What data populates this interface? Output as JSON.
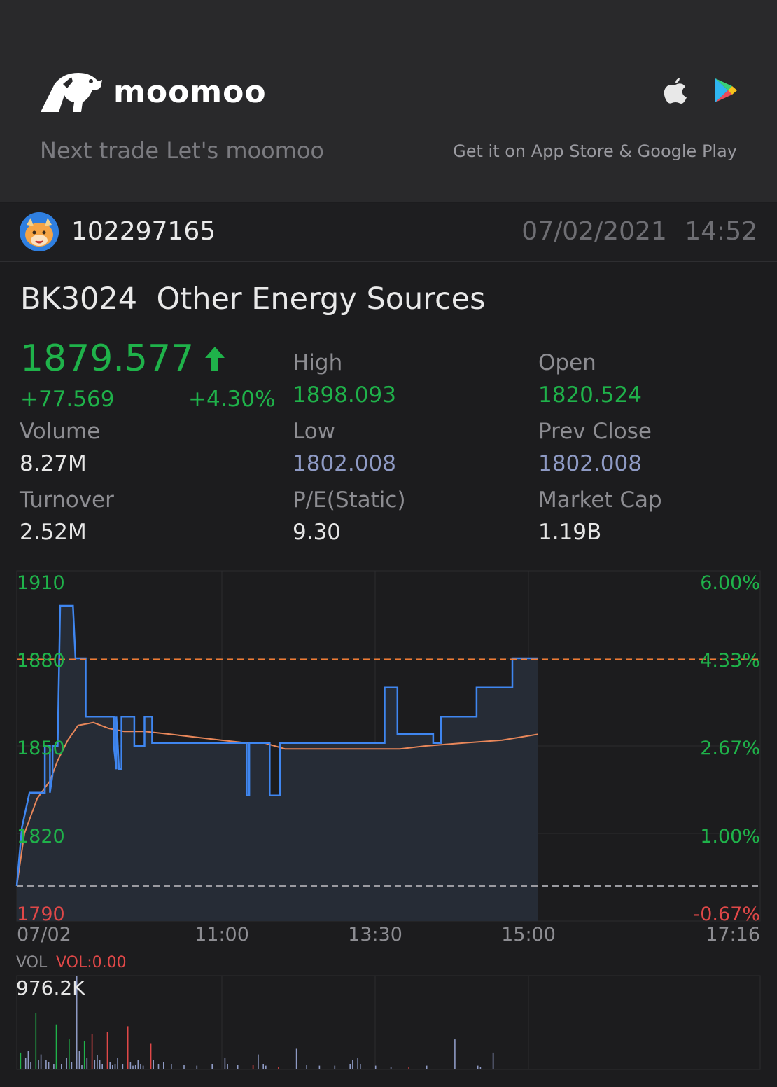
{
  "banner": {
    "brand": "moomoo",
    "tagline": "Next trade Let's moomoo",
    "store_text": "Get it on App Store & Google Play",
    "icons": [
      "apple-icon",
      "google-play-icon"
    ]
  },
  "user": {
    "id": "102297165",
    "date": "07/02/2021",
    "time": "14:52"
  },
  "stock": {
    "code": "BK3024",
    "name": "Other Energy Sources",
    "price": "1879.577",
    "change": "+77.569",
    "change_pct": "+4.30%",
    "direction_icon": "up-arrow-icon"
  },
  "quote": {
    "high_label": "High",
    "high": "1898.093",
    "open_label": "Open",
    "open": "1820.524",
    "volume_label": "Volume",
    "volume": "8.27M",
    "low_label": "Low",
    "low": "1802.008",
    "prev_close_label": "Prev Close",
    "prev_close": "1802.008",
    "turnover_label": "Turnover",
    "turnover": "2.52M",
    "pe_label": "P/E(Static)",
    "pe": "9.30",
    "market_cap_label": "Market Cap",
    "market_cap": "1.19B"
  },
  "colors": {
    "up": "#1fb24a",
    "down": "#e04848",
    "price_line": "#3f86f0",
    "avg_line": "#e8875a",
    "neutral_blue": "#8e9ac4"
  },
  "chart_data": [
    {
      "type": "line",
      "y_ticks_left": [
        "1910",
        "1880",
        "1850",
        "1820",
        "1790"
      ],
      "y_ticks_right": [
        "6.00%",
        "4.33%",
        "2.67%",
        "1.00%",
        "-0.67%"
      ],
      "x_ticks": [
        "07/02",
        "11:00",
        "13:30",
        "15:00",
        "17:16"
      ],
      "ylim": [
        1790,
        1910
      ],
      "reference_lines": {
        "current": 1879.577,
        "prev_close": 1802.008
      },
      "series": [
        {
          "values": [
            [
              0,
              1802
            ],
            [
              2,
              1822
            ],
            [
              5,
              1834
            ],
            [
              5,
              1834
            ],
            [
              11,
              1834
            ],
            [
              11,
              1850
            ],
            [
              13,
              1850
            ],
            [
              13,
              1834
            ],
            [
              14,
              1840
            ],
            [
              14,
              1850
            ],
            [
              16,
              1850
            ],
            [
              16,
              1850
            ],
            [
              17,
              1898
            ],
            [
              22,
              1898
            ],
            [
              23,
              1880
            ],
            [
              27,
              1880
            ],
            [
              27,
              1860
            ],
            [
              36,
              1860
            ],
            [
              38,
              1860
            ],
            [
              38,
              1850
            ],
            [
              39,
              1842
            ],
            [
              39,
              1860
            ],
            [
              40,
              1842
            ],
            [
              41,
              1842
            ],
            [
              41,
              1860
            ],
            [
              46,
              1860
            ],
            [
              46,
              1850
            ],
            [
              50,
              1850
            ],
            [
              50,
              1860
            ],
            [
              53,
              1860
            ],
            [
              53,
              1851
            ],
            [
              90,
              1851
            ],
            [
              90,
              1833
            ],
            [
              91,
              1833
            ],
            [
              91,
              1851
            ],
            [
              99,
              1851
            ],
            [
              99,
              1833
            ],
            [
              103,
              1833
            ],
            [
              103,
              1851
            ],
            [
              144,
              1851
            ],
            [
              144,
              1870
            ],
            [
              149,
              1870
            ],
            [
              149,
              1854
            ],
            [
              163,
              1854
            ],
            [
              163,
              1851
            ],
            [
              166,
              1851
            ],
            [
              166,
              1860
            ],
            [
              180,
              1860
            ],
            [
              180,
              1870
            ],
            [
              194,
              1870
            ],
            [
              194,
              1880
            ],
            [
              204,
              1880
            ]
          ]
        },
        {
          "values": [
            [
              0,
              1802
            ],
            [
              3,
              1820
            ],
            [
              8,
              1832
            ],
            [
              13,
              1838
            ],
            [
              16,
              1845
            ],
            [
              20,
              1852
            ],
            [
              24,
              1857
            ],
            [
              30,
              1858
            ],
            [
              36,
              1856
            ],
            [
              42,
              1855
            ],
            [
              50,
              1855
            ],
            [
              60,
              1854
            ],
            [
              70,
              1853
            ],
            [
              80,
              1852
            ],
            [
              90,
              1851
            ],
            [
              97,
              1851
            ],
            [
              105,
              1849
            ],
            [
              130,
              1849
            ],
            [
              150,
              1849
            ],
            [
              160,
              1850
            ],
            [
              175,
              1851
            ],
            [
              190,
              1852
            ],
            [
              204,
              1854
            ]
          ]
        }
      ]
    },
    {
      "type": "bar",
      "title": "VOL",
      "ylabel": "VOL:0.00",
      "max_label": "976.2K",
      "values": [
        {
          "x": 1,
          "v": 0.18,
          "c": "g"
        },
        {
          "x": 3,
          "v": 0.12,
          "c": "b"
        },
        {
          "x": 4,
          "v": 0.2,
          "c": "b"
        },
        {
          "x": 5,
          "v": 0.08,
          "c": "b"
        },
        {
          "x": 7,
          "v": 0.6,
          "c": "g"
        },
        {
          "x": 8,
          "v": 0.1,
          "c": "b"
        },
        {
          "x": 9,
          "v": 0.16,
          "c": "b"
        },
        {
          "x": 11,
          "v": 0.1,
          "c": "b"
        },
        {
          "x": 12,
          "v": 0.08,
          "c": "b"
        },
        {
          "x": 14,
          "v": 0.06,
          "c": "b"
        },
        {
          "x": 15,
          "v": 0.48,
          "c": "g"
        },
        {
          "x": 17,
          "v": 0.06,
          "c": "b"
        },
        {
          "x": 19,
          "v": 0.12,
          "c": "b"
        },
        {
          "x": 20,
          "v": 0.32,
          "c": "g"
        },
        {
          "x": 21,
          "v": 0.08,
          "c": "b"
        },
        {
          "x": 23,
          "v": 1.0,
          "c": "b"
        },
        {
          "x": 24,
          "v": 0.2,
          "c": "b"
        },
        {
          "x": 25,
          "v": 0.05,
          "c": "b"
        },
        {
          "x": 26,
          "v": 0.3,
          "c": "g"
        },
        {
          "x": 27,
          "v": 0.12,
          "c": "b"
        },
        {
          "x": 29,
          "v": 0.38,
          "c": "r"
        },
        {
          "x": 30,
          "v": 0.1,
          "c": "b"
        },
        {
          "x": 31,
          "v": 0.15,
          "c": "b"
        },
        {
          "x": 32,
          "v": 0.1,
          "c": "b"
        },
        {
          "x": 33,
          "v": 0.06,
          "c": "b"
        },
        {
          "x": 35,
          "v": 0.4,
          "c": "r"
        },
        {
          "x": 36,
          "v": 0.08,
          "c": "b"
        },
        {
          "x": 37,
          "v": 0.05,
          "c": "b"
        },
        {
          "x": 38,
          "v": 0.06,
          "c": "b"
        },
        {
          "x": 39,
          "v": 0.12,
          "c": "b"
        },
        {
          "x": 41,
          "v": 0.06,
          "c": "b"
        },
        {
          "x": 43,
          "v": 0.46,
          "c": "r"
        },
        {
          "x": 44,
          "v": 0.08,
          "c": "b"
        },
        {
          "x": 45,
          "v": 0.04,
          "c": "b"
        },
        {
          "x": 46,
          "v": 0.05,
          "c": "b"
        },
        {
          "x": 47,
          "v": 0.1,
          "c": "b"
        },
        {
          "x": 48,
          "v": 0.06,
          "c": "b"
        },
        {
          "x": 49,
          "v": 0.04,
          "c": "b"
        },
        {
          "x": 52,
          "v": 0.28,
          "c": "r"
        },
        {
          "x": 53,
          "v": 0.1,
          "c": "b"
        },
        {
          "x": 55,
          "v": 0.06,
          "c": "b"
        },
        {
          "x": 57,
          "v": 0.08,
          "c": "b"
        },
        {
          "x": 60,
          "v": 0.06,
          "c": "b"
        },
        {
          "x": 65,
          "v": 0.05,
          "c": "b"
        },
        {
          "x": 70,
          "v": 0.04,
          "c": "b"
        },
        {
          "x": 76,
          "v": 0.06,
          "c": "b"
        },
        {
          "x": 81,
          "v": 0.12,
          "c": "b"
        },
        {
          "x": 82,
          "v": 0.06,
          "c": "b"
        },
        {
          "x": 86,
          "v": 0.05,
          "c": "b"
        },
        {
          "x": 92,
          "v": 0.05,
          "c": "r"
        },
        {
          "x": 94,
          "v": 0.16,
          "c": "b"
        },
        {
          "x": 96,
          "v": 0.06,
          "c": "b"
        },
        {
          "x": 97,
          "v": 0.04,
          "c": "b"
        },
        {
          "x": 102,
          "v": 0.03,
          "c": "r"
        },
        {
          "x": 109,
          "v": 0.22,
          "c": "b"
        },
        {
          "x": 113,
          "v": 0.05,
          "c": "b"
        },
        {
          "x": 118,
          "v": 0.04,
          "c": "b"
        },
        {
          "x": 124,
          "v": 0.04,
          "c": "b"
        },
        {
          "x": 130,
          "v": 0.06,
          "c": "b"
        },
        {
          "x": 131,
          "v": 0.1,
          "c": "b"
        },
        {
          "x": 133,
          "v": 0.12,
          "c": "b"
        },
        {
          "x": 134,
          "v": 0.06,
          "c": "b"
        },
        {
          "x": 140,
          "v": 0.04,
          "c": "b"
        },
        {
          "x": 146,
          "v": 0.03,
          "c": "b"
        },
        {
          "x": 153,
          "v": 0.03,
          "c": "r"
        },
        {
          "x": 160,
          "v": 0.04,
          "c": "b"
        },
        {
          "x": 171,
          "v": 0.32,
          "c": "b"
        },
        {
          "x": 180,
          "v": 0.04,
          "c": "b"
        },
        {
          "x": 181,
          "v": 0.03,
          "c": "b"
        },
        {
          "x": 186,
          "v": 0.18,
          "c": "b"
        }
      ]
    }
  ]
}
